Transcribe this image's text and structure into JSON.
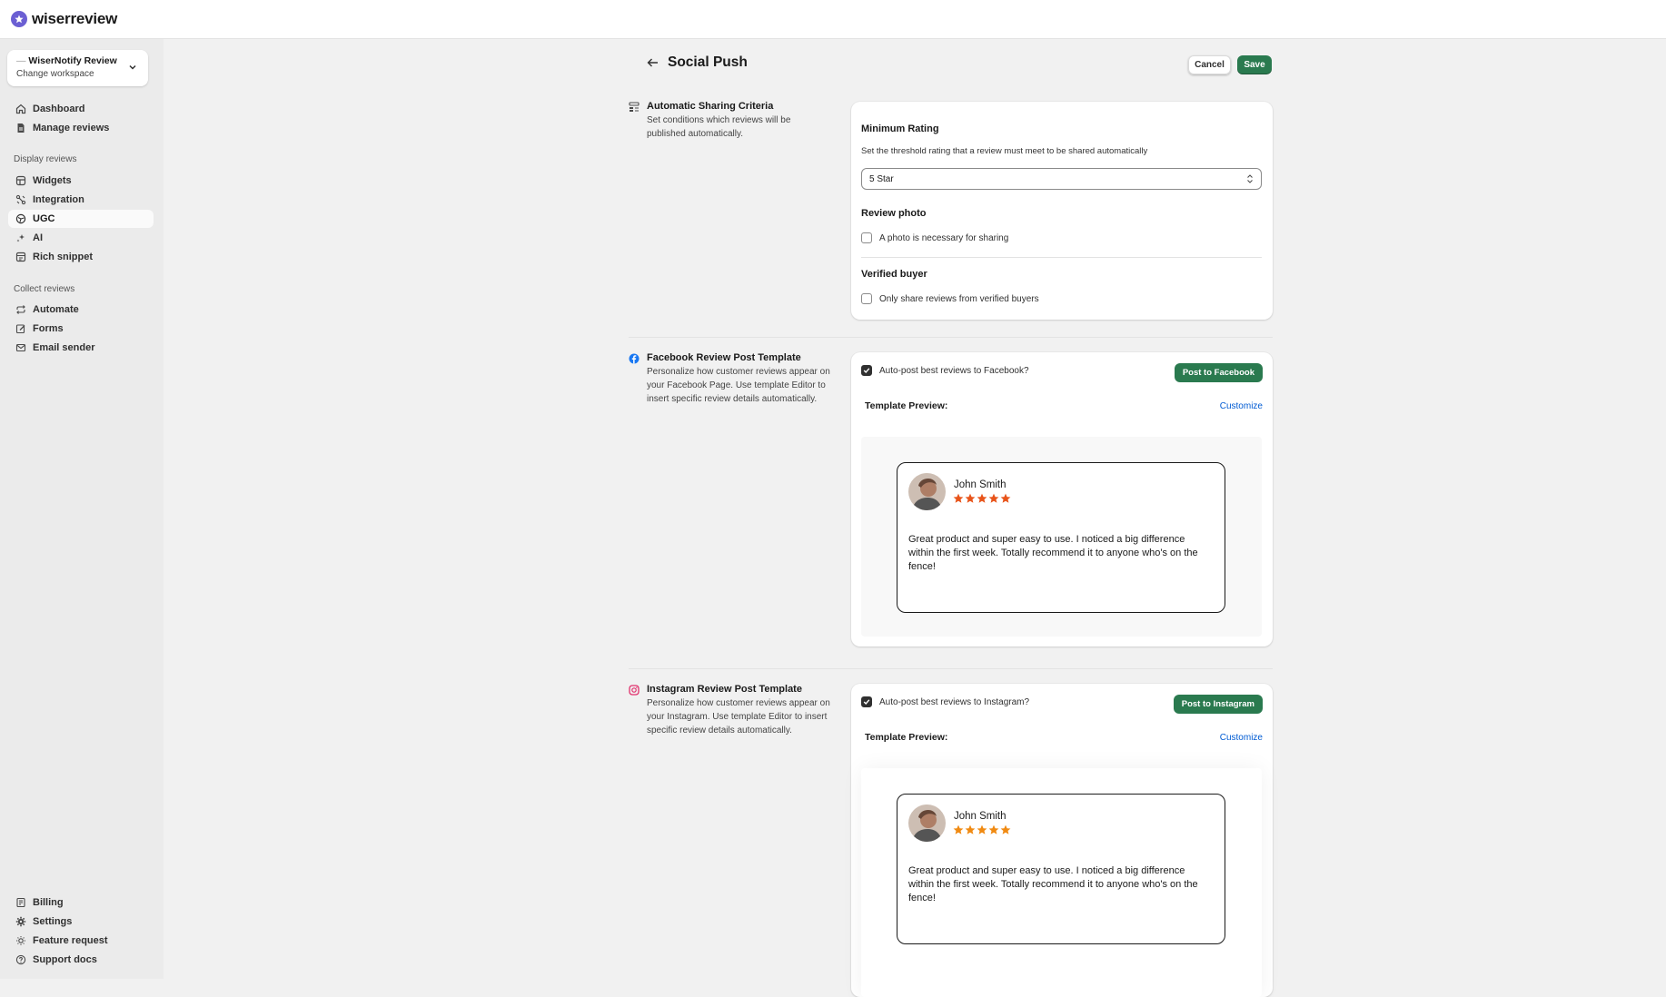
{
  "brand": {
    "name": "wiserreview",
    "accent": "#6b5fd3"
  },
  "workspace": {
    "name": "WiserNotify Review",
    "subtitle": "Change workspace"
  },
  "nav": {
    "main": [
      {
        "label": "Dashboard",
        "icon": "home-icon"
      },
      {
        "label": "Manage reviews",
        "icon": "document-icon"
      }
    ],
    "display_section": "Display reviews",
    "display": [
      {
        "label": "Widgets",
        "icon": "widgets-icon"
      },
      {
        "label": "Integration",
        "icon": "integration-icon"
      },
      {
        "label": "UGC",
        "icon": "ugc-icon",
        "active": true
      },
      {
        "label": "AI",
        "icon": "sparkle-icon"
      },
      {
        "label": "Rich snippet",
        "icon": "snippet-icon"
      }
    ],
    "collect_section": "Collect reviews",
    "collect": [
      {
        "label": "Automate",
        "icon": "repeat-icon"
      },
      {
        "label": "Forms",
        "icon": "form-edit-icon"
      },
      {
        "label": "Email sender",
        "icon": "email-icon"
      }
    ],
    "bottom": [
      {
        "label": "Billing",
        "icon": "billing-icon"
      },
      {
        "label": "Settings",
        "icon": "gear-icon"
      },
      {
        "label": "Feature request",
        "icon": "bulb-icon"
      },
      {
        "label": "Support docs",
        "icon": "help-icon"
      }
    ]
  },
  "page": {
    "title": "Social Push",
    "cancel_label": "Cancel",
    "save_label": "Save",
    "primary_color": "#2a7a4f"
  },
  "criteria": {
    "title": "Automatic Sharing Criteria",
    "description": "Set conditions which reviews will be published automatically.",
    "min_rating_title": "Minimum Rating",
    "min_rating_help": "Set the threshold rating that a review must meet to be shared automatically",
    "min_rating_value": "5 Star",
    "photo_title": "Review photo",
    "photo_checkbox": "A photo is necessary for sharing",
    "photo_checked": false,
    "verified_title": "Verified buyer",
    "verified_checkbox": "Only share reviews from verified buyers",
    "verified_checked": false
  },
  "facebook": {
    "title": "Facebook Review Post Template",
    "description": "Personalize how customer reviews appear on your Facebook Page. Use template Editor to insert specific review details automatically.",
    "auto_post_label": "Auto-post best reviews to Facebook?",
    "auto_post_checked": true,
    "post_button": "Post to Facebook",
    "preview_label": "Template Preview:",
    "customize_label": "Customize",
    "icon_color": "#1877f2",
    "star_color": "#e8541a",
    "review": {
      "name": "John Smith",
      "rating": 5,
      "text": "Great product and super easy to use. I noticed a big difference within the first week. Totally recommend it to anyone who's on the fence!"
    }
  },
  "instagram": {
    "title": "Instagram Review Post Template",
    "description": "Personalize how customer reviews appear on your Instagram. Use template Editor to insert specific review details automatically.",
    "auto_post_label": "Auto-post best reviews to Instagram?",
    "auto_post_checked": true,
    "post_button": "Post to Instagram",
    "preview_label": "Template Preview:",
    "customize_label": "Customize",
    "icon_color": "#e1306c",
    "star_color": "#f08a12",
    "review": {
      "name": "John Smith",
      "rating": 5,
      "text": "Great product and super easy to use. I noticed a big difference within the first week. Totally recommend it to anyone who's on the fence!"
    }
  }
}
